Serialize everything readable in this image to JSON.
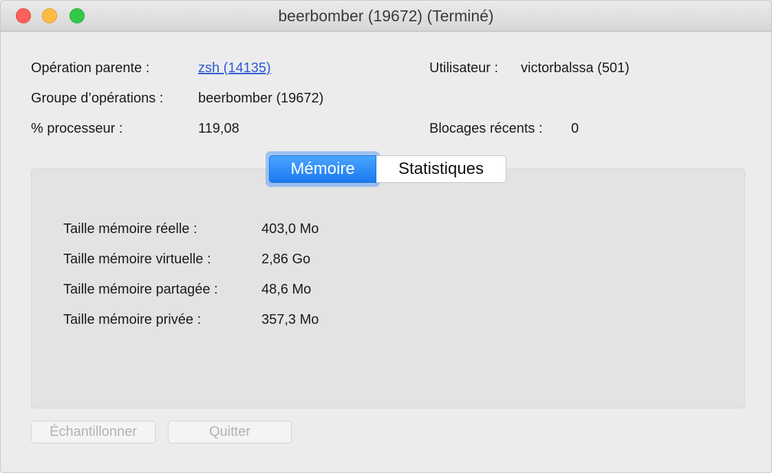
{
  "window": {
    "title": "beerbomber (19672) (Terminé)"
  },
  "info": {
    "parent_label": "Opération parente :",
    "parent_value": "zsh (14135)",
    "group_label": "Groupe d’opérations :",
    "group_value": "beerbomber (19672)",
    "cpu_label": "% processeur :",
    "cpu_value": "119,08",
    "user_label": "Utilisateur :",
    "user_value": "victorbalssa (501)",
    "hangs_label": "Blocages récents :",
    "hangs_value": "0"
  },
  "tabs": {
    "memory": "Mémoire",
    "statistics": "Statistiques",
    "selected": "memory",
    "accent_color": "#1a7bf0"
  },
  "memory": {
    "rows": [
      {
        "label": "Taille mémoire réelle :",
        "value": "403,0 Mo"
      },
      {
        "label": "Taille mémoire virtuelle :",
        "value": "2,86 Go"
      },
      {
        "label": "Taille mémoire partagée :",
        "value": "48,6 Mo"
      },
      {
        "label": "Taille mémoire privée :",
        "value": "357,3 Mo"
      }
    ]
  },
  "buttons": {
    "sample": "Échantillonner",
    "quit": "Quitter"
  },
  "colors": {
    "close": "#fc605c",
    "minimize": "#fdbc40",
    "zoom": "#34c84a",
    "link": "#2a5bd7"
  }
}
